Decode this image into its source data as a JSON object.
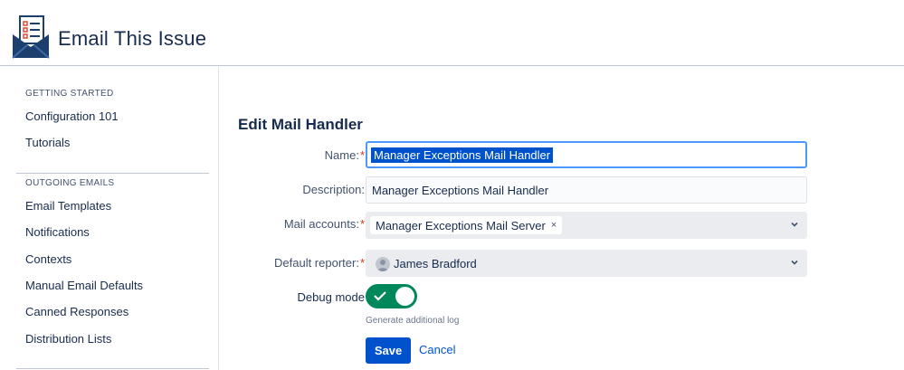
{
  "app": {
    "title": "Email This Issue",
    "logo_icon": "envelope-checklist-icon"
  },
  "sidebar": {
    "sections": [
      {
        "heading": "GETTING STARTED",
        "items": [
          "Configuration 101",
          "Tutorials"
        ]
      },
      {
        "heading": "OUTGOING EMAILS",
        "items": [
          "Email Templates",
          "Notifications",
          "Contexts",
          "Manual Email Defaults",
          "Canned Responses",
          "Distribution Lists"
        ]
      }
    ]
  },
  "form": {
    "title": "Edit Mail Handler",
    "name": {
      "label": "Name:",
      "required": "*",
      "value": "Manager Exceptions Mail Handler"
    },
    "description": {
      "label": "Description:",
      "value": "Manager Exceptions Mail Handler"
    },
    "mail_accounts": {
      "label": "Mail accounts:",
      "required": "*",
      "chips": [
        "Manager Exceptions Mail Server"
      ],
      "remove_glyph": "×"
    },
    "default_reporter": {
      "label": "Default reporter:",
      "required": "*",
      "value": "James Bradford"
    },
    "debug_mode": {
      "label": "Debug mode",
      "enabled": true,
      "help": "Generate additional log"
    },
    "save_label": "Save",
    "cancel_label": "Cancel"
  },
  "colors": {
    "primary": "#0052cc",
    "toggle_on": "#00875a",
    "required": "#de350b",
    "focus": "#4c9aff"
  }
}
